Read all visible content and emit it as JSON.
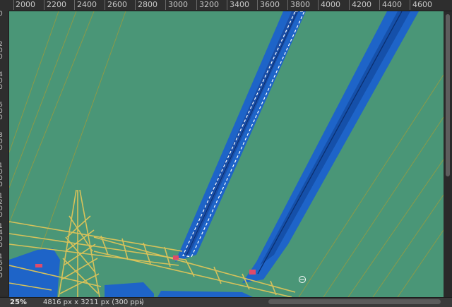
{
  "ruler": {
    "top_labels": [
      "2000",
      "2200",
      "2400",
      "2600",
      "2800",
      "3000",
      "3200",
      "3400",
      "3600",
      "3800",
      "4000",
      "4200",
      "4400",
      "4600"
    ],
    "left_labels": [
      "0",
      "2 0 0",
      "4 0 0",
      "6 0 0",
      "8 0 0",
      "1 0 0 0",
      "1 2 0 0",
      "1 4 0 0",
      "1 6 0 0"
    ]
  },
  "status": {
    "zoom": "25%",
    "document_size": "4816 px x 3211 px (300 ppi)",
    "chevron": "›"
  },
  "canvas": {
    "background_color": "#4a9677",
    "mask_color": "#1e64c8",
    "tower_color": "#d7c25a",
    "cursor_icon": "brush-cursor-icon"
  }
}
